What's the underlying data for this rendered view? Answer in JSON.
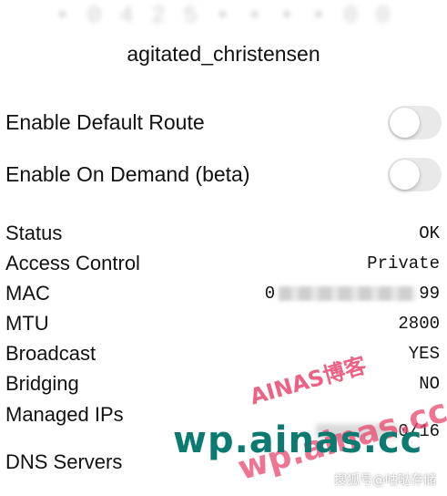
{
  "header": {
    "network_id_hidden": "• 0 4 2 5 • • • • 0 0",
    "network_name": "agitated_christensen"
  },
  "toggles": [
    {
      "label": "Enable Default Route",
      "on": false
    },
    {
      "label": "Enable On Demand (beta)",
      "on": false
    }
  ],
  "info": {
    "status": {
      "label": "Status",
      "value": "OK"
    },
    "access_control": {
      "label": "Access Control",
      "value": "Private"
    },
    "mac": {
      "label": "MAC",
      "prefix": "0",
      "suffix": "99"
    },
    "mtu": {
      "label": "MTU",
      "value": "2800"
    },
    "broadcast": {
      "label": "Broadcast",
      "value": "YES"
    },
    "bridging": {
      "label": "Bridging",
      "value": "NO"
    },
    "managed_ips": {
      "label": "Managed IPs",
      "suffix": "0/16"
    },
    "dns_servers": {
      "label": "DNS Servers",
      "value": ""
    }
  },
  "watermarks": {
    "small": "AINAS博客",
    "big": "wp.ainas.cc",
    "pink": "wp.ainas.cc",
    "corner": "搜狐号@咕哒存储"
  }
}
